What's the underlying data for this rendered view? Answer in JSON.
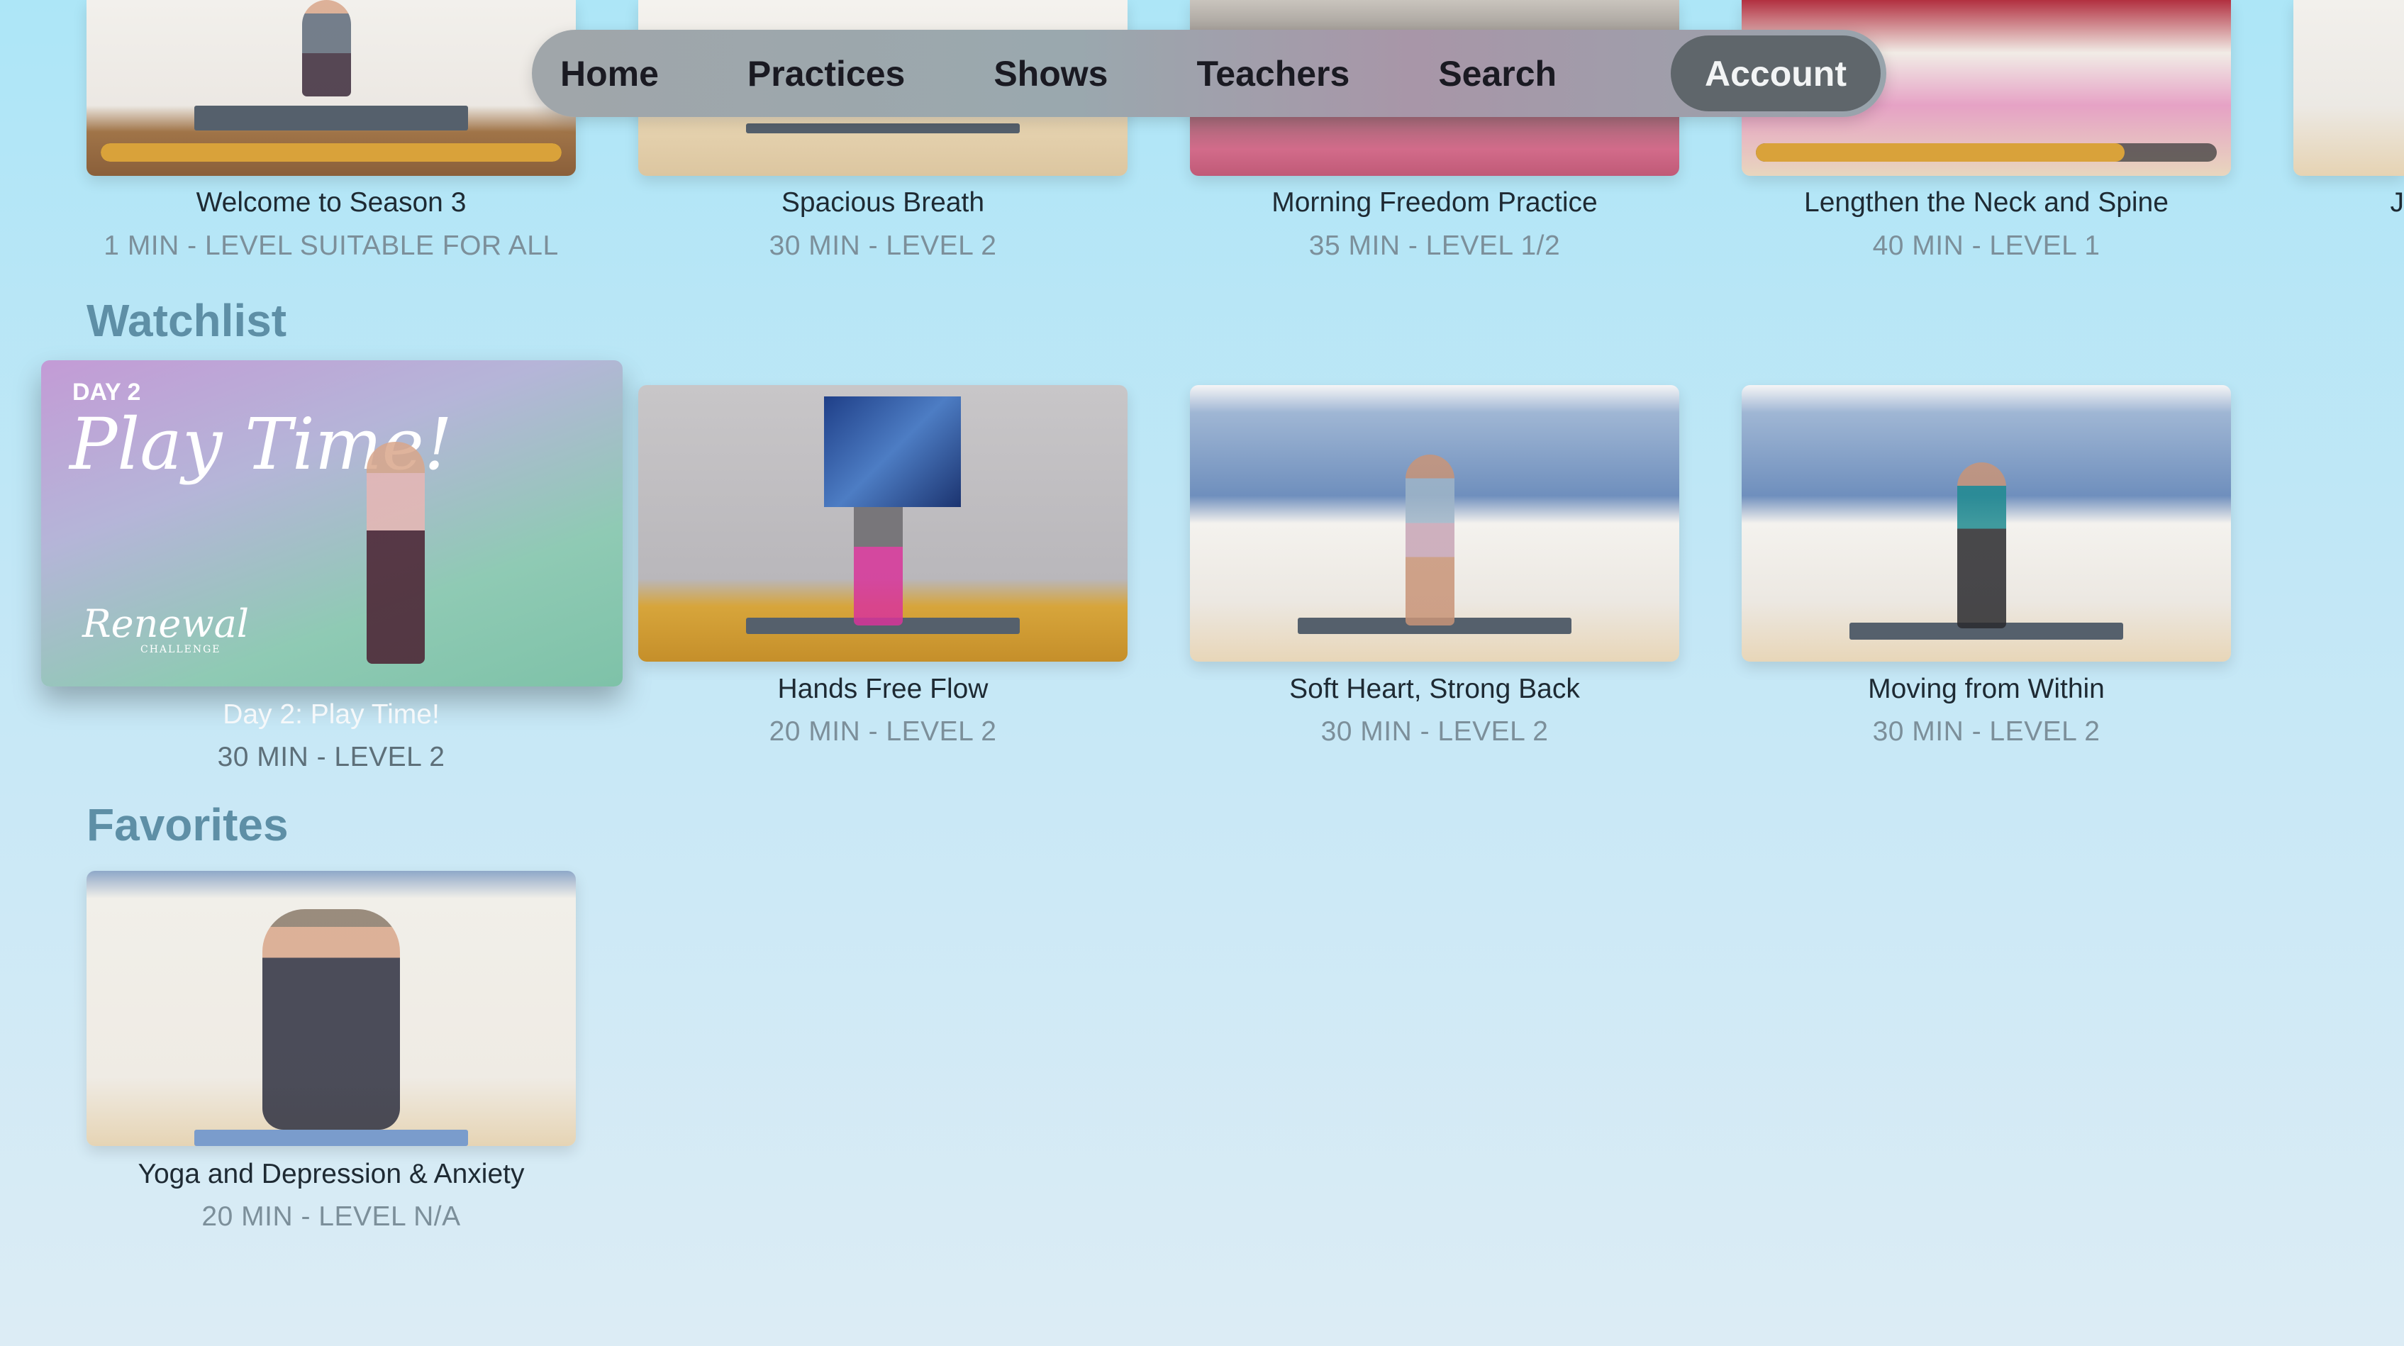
{
  "nav": {
    "items": [
      "Home",
      "Practices",
      "Shows",
      "Teachers",
      "Search",
      "Account"
    ],
    "active": "Account"
  },
  "top_row": [
    {
      "title": "Welcome to Season 3",
      "meta": "1 MIN - LEVEL SUITABLE FOR ALL",
      "progress": 1.0
    },
    {
      "title": "Spacious Breath",
      "meta": "30 MIN - LEVEL 2"
    },
    {
      "title": "Morning Freedom Practice",
      "meta": "35 MIN - LEVEL 1/2"
    },
    {
      "title": "Lengthen the Neck and Spine",
      "meta": "40 MIN - LEVEL 1",
      "progress": 0.8
    },
    {
      "title": "J"
    }
  ],
  "watchlist": {
    "heading": "Watchlist",
    "items": [
      {
        "title": "Day 2: Play Time!",
        "meta": "30 MIN - LEVEL 2",
        "focused": true,
        "thumb_text": {
          "day": "DAY 2",
          "name": "Play Time!",
          "brand": "Renewal",
          "brand_sub": "CHALLENGE"
        }
      },
      {
        "title": "Hands Free Flow",
        "meta": "20 MIN - LEVEL 2"
      },
      {
        "title": "Soft Heart, Strong Back",
        "meta": "30 MIN - LEVEL 2"
      },
      {
        "title": "Moving from Within",
        "meta": "30 MIN - LEVEL 2"
      }
    ]
  },
  "favorites": {
    "heading": "Favorites",
    "items": [
      {
        "title": "Yoga and Depression & Anxiety",
        "meta": "20 MIN - LEVEL N/A"
      }
    ]
  },
  "colors": {
    "progress": "#d9a23a",
    "section_heading": "#5e8fa6",
    "nav_active": "#5f666b"
  }
}
